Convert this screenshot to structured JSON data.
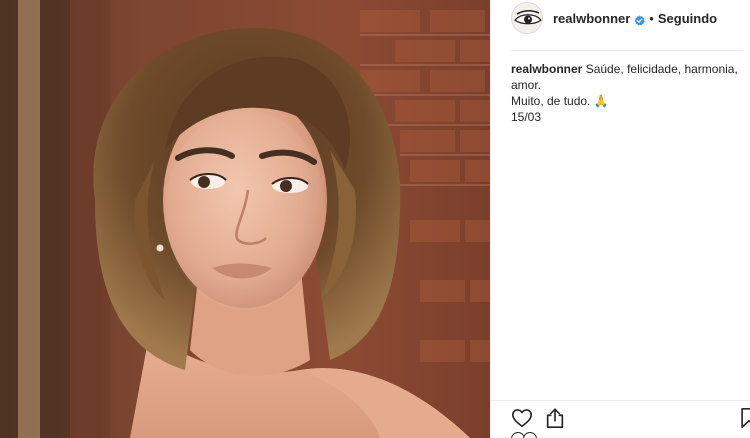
{
  "post": {
    "image_alt": "portrait photo",
    "author": {
      "username": "realwbonner",
      "verified": true,
      "separator": "•",
      "follow_status": "Seguindo"
    },
    "caption": {
      "username": "realwbonner",
      "line1": "Saúde, felicidade, harmonia, amor.",
      "line2": "Muito, de tudo. 🙏",
      "line3": "15/03"
    }
  },
  "icons": {
    "like": "heart-icon",
    "share": "share-icon",
    "save": "bookmark-icon",
    "verified": "verified-badge-icon"
  },
  "colors": {
    "text": "#262626",
    "verified_blue": "#3897f0",
    "divider": "#efefef"
  }
}
